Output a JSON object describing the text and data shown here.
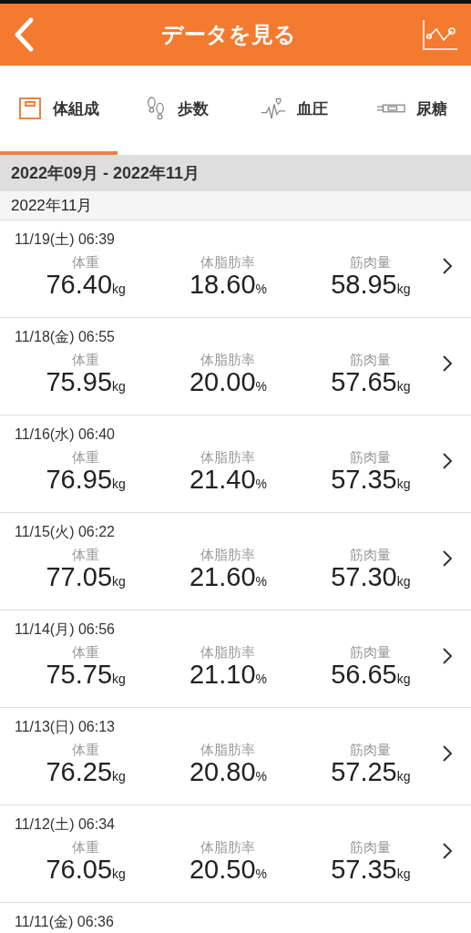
{
  "header": {
    "title": "データを見る"
  },
  "tabs": [
    {
      "label": "体組成",
      "selected": true
    },
    {
      "label": "歩数",
      "selected": false
    },
    {
      "label": "血圧",
      "selected": false
    },
    {
      "label": "尿糖",
      "selected": false
    }
  ],
  "period": "2022年09月 - 2022年11月",
  "month": "2022年11月",
  "records": [
    {
      "datetime": "11/19(土) 06:39",
      "metrics": [
        {
          "label": "体重",
          "value": "76.40",
          "unit": "kg"
        },
        {
          "label": "体脂肪率",
          "value": "18.60",
          "unit": "%"
        },
        {
          "label": "筋肉量",
          "value": "58.95",
          "unit": "kg"
        }
      ]
    },
    {
      "datetime": "11/18(金) 06:55",
      "metrics": [
        {
          "label": "体重",
          "value": "75.95",
          "unit": "kg"
        },
        {
          "label": "体脂肪率",
          "value": "20.00",
          "unit": "%"
        },
        {
          "label": "筋肉量",
          "value": "57.65",
          "unit": "kg"
        }
      ]
    },
    {
      "datetime": "11/16(水) 06:40",
      "metrics": [
        {
          "label": "体重",
          "value": "76.95",
          "unit": "kg"
        },
        {
          "label": "体脂肪率",
          "value": "21.40",
          "unit": "%"
        },
        {
          "label": "筋肉量",
          "value": "57.35",
          "unit": "kg"
        }
      ]
    },
    {
      "datetime": "11/15(火) 06:22",
      "metrics": [
        {
          "label": "体重",
          "value": "77.05",
          "unit": "kg"
        },
        {
          "label": "体脂肪率",
          "value": "21.60",
          "unit": "%"
        },
        {
          "label": "筋肉量",
          "value": "57.30",
          "unit": "kg"
        }
      ]
    },
    {
      "datetime": "11/14(月) 06:56",
      "metrics": [
        {
          "label": "体重",
          "value": "75.75",
          "unit": "kg"
        },
        {
          "label": "体脂肪率",
          "value": "21.10",
          "unit": "%"
        },
        {
          "label": "筋肉量",
          "value": "56.65",
          "unit": "kg"
        }
      ]
    },
    {
      "datetime": "11/13(日) 06:13",
      "metrics": [
        {
          "label": "体重",
          "value": "76.25",
          "unit": "kg"
        },
        {
          "label": "体脂肪率",
          "value": "20.80",
          "unit": "%"
        },
        {
          "label": "筋肉量",
          "value": "57.25",
          "unit": "kg"
        }
      ]
    },
    {
      "datetime": "11/12(土) 06:34",
      "metrics": [
        {
          "label": "体重",
          "value": "76.05",
          "unit": "kg"
        },
        {
          "label": "体脂肪率",
          "value": "20.50",
          "unit": "%"
        },
        {
          "label": "筋肉量",
          "value": "57.35",
          "unit": "kg"
        }
      ]
    },
    {
      "datetime": "11/11(金) 06:36"
    }
  ]
}
